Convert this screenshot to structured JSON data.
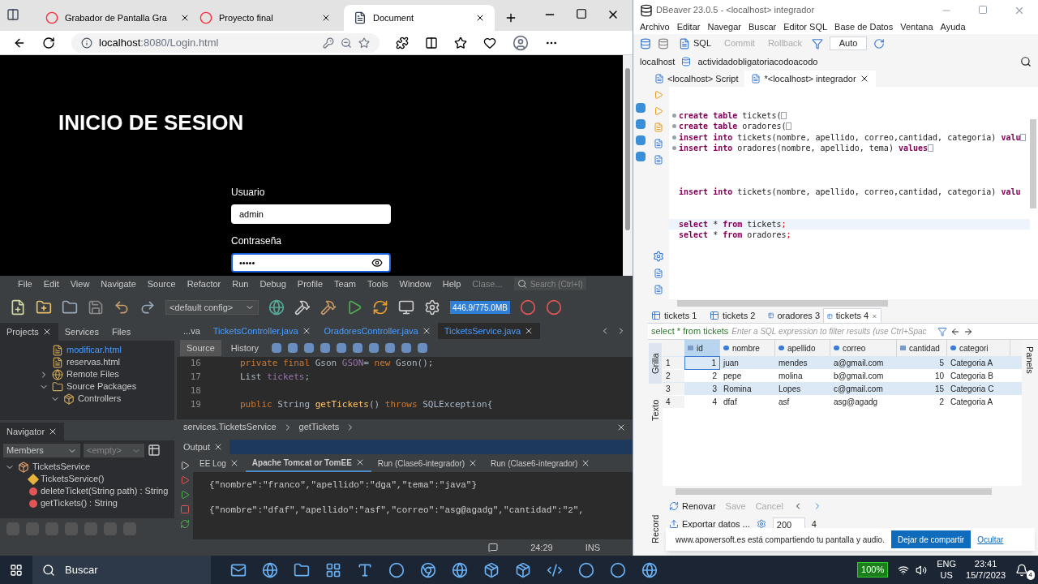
{
  "browser": {
    "tabs": [
      {
        "title": "Grabador de Pantalla Gra",
        "selected": false
      },
      {
        "title": "Proyecto final",
        "selected": false
      },
      {
        "title": "Document",
        "selected": true
      }
    ],
    "address_host": "localhost",
    "address_rest": ":8080/Login.html",
    "page": {
      "heading": "INICIO DE SESION",
      "fields": [
        {
          "label": "Usuario",
          "value": "admin",
          "kind": "text",
          "focused": false
        },
        {
          "label": "Contraseña",
          "value": "•••••",
          "kind": "password",
          "focused": true
        }
      ]
    }
  },
  "netbeans": {
    "menu": [
      "File",
      "Edit",
      "View",
      "Navigate",
      "Source",
      "Refactor",
      "Run",
      "Debug",
      "Profile",
      "Team",
      "Tools",
      "Window",
      "Help",
      "Clase..."
    ],
    "search_placeholder": "Search (Ctrl+I)",
    "config": "<default config>",
    "memory": "446.9/775.0MB",
    "panel_tabs": [
      {
        "label": "Projects",
        "selected": true
      },
      {
        "label": "Services",
        "selected": false
      },
      {
        "label": "Files",
        "selected": false
      }
    ],
    "tree": [
      {
        "label": "modificar.html",
        "kind": "file",
        "selected": true
      },
      {
        "label": "reservas.html",
        "kind": "file",
        "selected": false
      },
      {
        "label": "Remote Files",
        "kind": "globe",
        "expanded": false,
        "selected": false
      },
      {
        "label": "Source Packages",
        "kind": "folder",
        "expanded": true,
        "selected": false,
        "children": [
          {
            "label": "Controllers",
            "kind": "package",
            "expanded": true,
            "selected": false
          }
        ]
      }
    ],
    "editor_tabs": [
      {
        "label": "...va",
        "selected": false
      },
      {
        "label": "TicketsController.java",
        "selected": false
      },
      {
        "label": "OradoresController.java",
        "selected": false
      },
      {
        "label": "TicketsService.java",
        "selected": true
      }
    ],
    "editor_modes": [
      {
        "label": "Source",
        "selected": true
      },
      {
        "label": "History",
        "selected": false
      }
    ],
    "code": [
      {
        "number": "16",
        "segments": [
          {
            "text": "private final ",
            "kind": "keyword"
          },
          {
            "text": "Gson ",
            "kind": "plain"
          },
          {
            "text": "GSON",
            "kind": "field"
          },
          {
            "text": "= ",
            "kind": "plain"
          },
          {
            "text": "new ",
            "kind": "keyword"
          },
          {
            "text": "Gson();",
            "kind": "plain"
          }
        ]
      },
      {
        "number": "17",
        "segments": [
          {
            "text": "List ",
            "kind": "plain"
          },
          {
            "text": "tickets",
            "kind": "field"
          },
          {
            "text": ";",
            "kind": "plain"
          }
        ]
      },
      {
        "number": "18"
      },
      {
        "number": "19",
        "segments": [
          {
            "text": "public ",
            "kind": "keyword"
          },
          {
            "text": "String ",
            "kind": "plain"
          },
          {
            "text": "getTickets",
            "kind": "method"
          },
          {
            "text": "() ",
            "kind": "plain"
          },
          {
            "text": "throws ",
            "kind": "keyword"
          },
          {
            "text": "SQLException{",
            "kind": "plain"
          }
        ]
      }
    ],
    "breadcrumb": [
      "services.TicketsService",
      "getTickets"
    ],
    "navigator": {
      "title": "Navigator",
      "filter": "Members",
      "filter2": "<empty>",
      "tree": [
        {
          "label": "TicketsService",
          "kind": "class",
          "expanded": true,
          "children": [
            {
              "label": "TicketsService()",
              "kind": "constructor"
            },
            {
              "label": "deleteTicket(String path) : String",
              "kind": "method"
            },
            {
              "label": "getTickets() : String",
              "kind": "method"
            }
          ]
        }
      ]
    },
    "output": {
      "title": "Output",
      "tabs": [
        {
          "label": "EE Log",
          "selected": false
        },
        {
          "label": "Apache Tomcat or TomEE",
          "selected": true
        },
        {
          "label": "Run (Clase6-integrador)",
          "selected": false
        },
        {
          "label": "Run (Clase6-integrador)",
          "selected": false
        }
      ],
      "lines": [
        "{\"nombre\":\"franco\",\"apellido\":\"dga\",\"tema\":\"java\"}",
        "{\"nombre\":\"dfaf\",\"apellido\":\"asf\",\"correo\":\"asg@agadg\",\"cantidad\":\"2\","
      ]
    },
    "status": {
      "position": "24:29",
      "mode": "INS"
    }
  },
  "dbeaver": {
    "title": "DBeaver 23.0.5 - <localhost> integrador",
    "menu": [
      "Archivo",
      "Editar",
      "Navegar",
      "Buscar",
      "Editor SQL",
      "Base de Datos",
      "Ventana",
      "Ayuda"
    ],
    "sql_button": "SQL",
    "commit": "Commit",
    "rollback": "Rollback",
    "mode": "Auto",
    "connection": "localhost",
    "database": "actividadobligatoriacodoacodo",
    "editor_tabs": [
      {
        "label": "<localhost> Script",
        "selected": false
      },
      {
        "label": "*<localhost> integrador",
        "selected": true
      }
    ],
    "sql": [
      {
        "kind": "blank"
      },
      {
        "kind": "blank"
      },
      {
        "kind": "folded",
        "segments": [
          {
            "text": "create table",
            "kind": "keyword"
          },
          {
            "text": " tickets(",
            "kind": "plain"
          }
        ]
      },
      {
        "kind": "folded",
        "segments": [
          {
            "text": "create table",
            "kind": "keyword"
          },
          {
            "text": " oradores(",
            "kind": "plain"
          }
        ]
      },
      {
        "kind": "folded",
        "segments": [
          {
            "text": "insert into",
            "kind": "keyword"
          },
          {
            "text": " tickets(nombre, apellido, correo,cantidad, categoria) ",
            "kind": "plain"
          },
          {
            "text": "valu",
            "kind": "keyword"
          }
        ]
      },
      {
        "kind": "folded",
        "segments": [
          {
            "text": "insert into",
            "kind": "keyword"
          },
          {
            "text": " oradores(nombre, apellido, tema) ",
            "kind": "plain"
          },
          {
            "text": "values",
            "kind": "keyword"
          }
        ]
      },
      {
        "kind": "blank"
      },
      {
        "kind": "blank"
      },
      {
        "kind": "blank"
      },
      {
        "kind": "line",
        "segments": [
          {
            "text": "insert into",
            "kind": "keyword"
          },
          {
            "text": " tickets(nombre, apellido, correo,cantidad, categoria) ",
            "kind": "plain"
          },
          {
            "text": "valu",
            "kind": "keyword"
          }
        ]
      },
      {
        "kind": "blank"
      },
      {
        "kind": "blank"
      },
      {
        "kind": "current",
        "segments": [
          {
            "text": "select",
            "kind": "keyword"
          },
          {
            "text": " * ",
            "kind": "plain"
          },
          {
            "text": "from",
            "kind": "keyword"
          },
          {
            "text": " tickets",
            "kind": "plain"
          },
          {
            "text": ";",
            "kind": "punct"
          }
        ]
      },
      {
        "kind": "line",
        "segments": [
          {
            "text": "select",
            "kind": "keyword"
          },
          {
            "text": " * ",
            "kind": "plain"
          },
          {
            "text": "from",
            "kind": "keyword"
          },
          {
            "text": " oradores",
            "kind": "plain"
          },
          {
            "text": ";",
            "kind": "punct"
          }
        ]
      }
    ],
    "result_tabs": [
      {
        "label": "tickets 1",
        "selected": false
      },
      {
        "label": "tickets 2",
        "selected": false
      },
      {
        "label": "oradores 3",
        "selected": false
      },
      {
        "label": "tickets 4",
        "selected": true
      }
    ],
    "filter_query": "select * from tickets",
    "filter_placeholder": "Enter a SQL expression to filter results (use Ctrl+Spac",
    "side_tabs": [
      {
        "label": "Grilla",
        "selected": true
      },
      {
        "label": "Texto",
        "selected": false
      }
    ],
    "record_tab": "Record",
    "panels_tab": "Panels",
    "columns": [
      {
        "name": "id",
        "kind": "number"
      },
      {
        "name": "nombre",
        "kind": "text"
      },
      {
        "name": "apellido",
        "kind": "text"
      },
      {
        "name": "correo",
        "kind": "text"
      },
      {
        "name": "cantidad",
        "kind": "number"
      },
      {
        "name": "categori",
        "kind": "text"
      }
    ],
    "rows": [
      {
        "number": "1",
        "selected": true,
        "cells": [
          "1",
          "juan",
          "mendes",
          "a@gmail.com",
          "5",
          "Categoria A"
        ]
      },
      {
        "number": "2",
        "selected": false,
        "cells": [
          "2",
          "pepe",
          "molina",
          "b@gmail.com",
          "10",
          "Categoria B"
        ]
      },
      {
        "number": "3",
        "selected": true,
        "cells": [
          "3",
          "Romina",
          "Lopes",
          "c@gmail.com",
          "15",
          "Categoria C"
        ]
      },
      {
        "number": "4",
        "selected": false,
        "cells": [
          "4",
          "dfaf",
          "asf",
          "asg@agadg",
          "2",
          "Categoria A"
        ]
      }
    ],
    "refresh": "Renovar",
    "save": "Save",
    "cancel": "Cancel",
    "export": "Exportar datos ...",
    "fetch_size": "200",
    "row_count": "4",
    "share_bar": {
      "message": "www.apowersoft.es está compartiendo tu pantalla y audio.",
      "button": "Dejar de compartir",
      "link": "Ocultar"
    }
  },
  "taskbar": {
    "search": "Buscar",
    "battery": "100%",
    "language": "ENG",
    "layout": "US",
    "time": "23:41",
    "date": "15/7/2023",
    "notifications": "4"
  }
}
